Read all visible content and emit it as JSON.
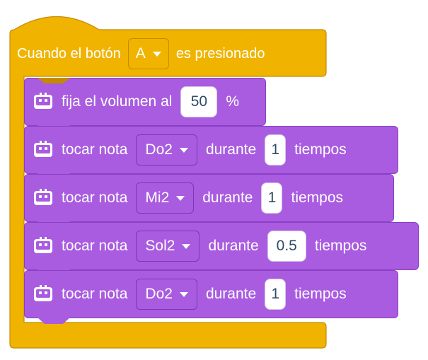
{
  "event_block": {
    "text_before": "Cuando el botón",
    "button_dropdown": "A",
    "text_after": "es presionado",
    "color": "#f0b400"
  },
  "blocks": [
    {
      "kind": "volume",
      "label": "fija el volumen al",
      "value": "50",
      "suffix": "%"
    },
    {
      "kind": "note",
      "label": "tocar nota",
      "note": "Do2",
      "during": "durante",
      "beats": "1",
      "unit": "tiempos"
    },
    {
      "kind": "note",
      "label": "tocar nota",
      "note": "Mi2",
      "during": "durante",
      "beats": "1",
      "unit": "tiempos"
    },
    {
      "kind": "note",
      "label": "tocar nota",
      "note": "Sol2",
      "during": "durante",
      "beats": "0.5",
      "unit": "tiempos"
    },
    {
      "kind": "note",
      "label": "tocar nota",
      "note": "Do2",
      "during": "durante",
      "beats": "1",
      "unit": "tiempos"
    }
  ],
  "colors": {
    "sound_block": "#a95ce0",
    "event_block": "#f0b400",
    "input_text": "#2f4b66"
  },
  "icons": {
    "block_icon": "robot-face-icon",
    "dropdown_icon": "caret-down-icon"
  }
}
